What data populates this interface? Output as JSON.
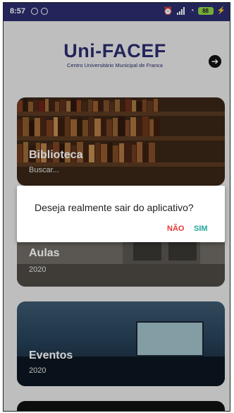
{
  "status_bar": {
    "time": "8:57",
    "battery": "88"
  },
  "header": {
    "logo_title": "Uni-FACEF",
    "logo_subtitle": "Centro Universitário Municipal de Franca",
    "exit_icon": "arrow-right-icon"
  },
  "cards": [
    {
      "title": "Biblioteca",
      "subtitle": "Buscar..."
    },
    {
      "title": "Aulas",
      "subtitle": "2020"
    },
    {
      "title": "Eventos",
      "subtitle": "2020"
    }
  ],
  "dialog": {
    "message": "Deseja realmente sair do aplicativo?",
    "no_label": "NÃO",
    "yes_label": "SIM"
  },
  "colors": {
    "brand": "#2b2d6e",
    "no": "#e53935",
    "yes": "#26a69a"
  }
}
